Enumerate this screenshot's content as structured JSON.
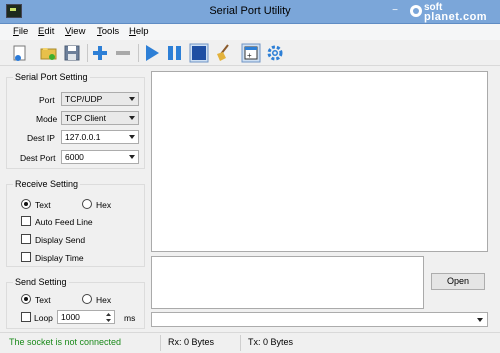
{
  "window": {
    "title": "Serial Port Utility",
    "minimize_glyph": "−",
    "watermark_line1": "soft",
    "watermark_line2": "planet.com"
  },
  "menu": [
    "File",
    "Edit",
    "View",
    "Tools",
    "Help"
  ],
  "toolbar": {
    "icons": [
      "new-icon",
      "open-folder-icon",
      "save-icon",
      "add-icon",
      "remove-icon",
      "play-icon",
      "pause-icon",
      "stop-icon",
      "clear-broom-icon",
      "window-icon",
      "settings-gear-icon"
    ]
  },
  "serial_port_setting": {
    "title": "Serial Port Setting",
    "port_label": "Port",
    "port_value": "TCP/UDP",
    "mode_label": "Mode",
    "mode_value": "TCP Client",
    "dest_ip_label": "Dest IP",
    "dest_ip_value": "127.0.0.1",
    "dest_port_label": "Dest Port",
    "dest_port_value": "6000"
  },
  "receive_setting": {
    "title": "Receive Setting",
    "text_label": "Text",
    "hex_label": "Hex",
    "selected": "Text",
    "auto_feed_line": "Auto Feed Line",
    "display_send": "Display Send",
    "display_time": "Display Time"
  },
  "send_setting": {
    "title": "Send Setting",
    "text_label": "Text",
    "hex_label": "Hex",
    "selected": "Text",
    "loop_label": "Loop",
    "loop_value": "1000",
    "loop_unit": "ms"
  },
  "open_button": "Open",
  "status": {
    "connection": "The socket is not connected",
    "connection_color": "#1a8a1a",
    "rx": "Rx: 0 Bytes",
    "tx": "Tx: 0 Bytes"
  }
}
